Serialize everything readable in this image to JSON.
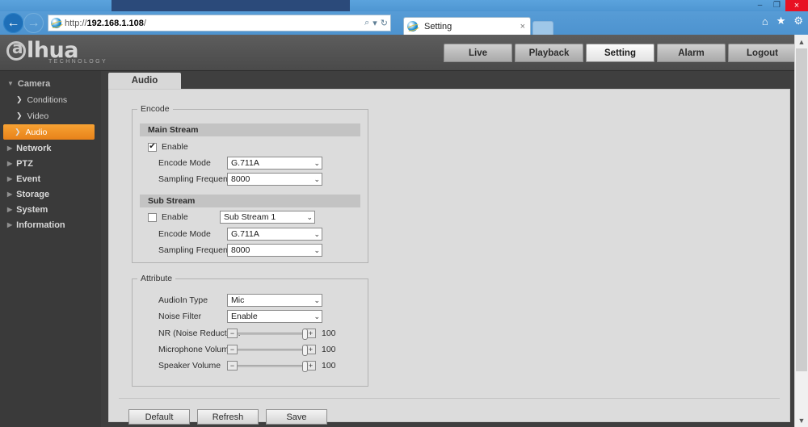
{
  "browser": {
    "url": "http://192.168.1.108/",
    "url_protocol": "http://",
    "url_host": "192.168.1.108",
    "url_path": "/",
    "tab_title": "Setting",
    "tab_close_label": "×",
    "back_icon": "back-arrow-icon",
    "forward_icon": "forward-arrow-icon",
    "search_icon": "⌕",
    "dropdown_icon": "▾",
    "refresh_icon": "↻",
    "home_icon": "⌂",
    "favorites_icon": "★",
    "tools_icon": "⚙",
    "window_minimize": "–",
    "window_maximize": "❐",
    "window_close": "×"
  },
  "header": {
    "logo_text": "lhua",
    "logo_sub": "TECHNOLOGY",
    "nav": [
      {
        "label": "Live",
        "active": false
      },
      {
        "label": "Playback",
        "active": false
      },
      {
        "label": "Setting",
        "active": true
      },
      {
        "label": "Alarm",
        "active": false
      },
      {
        "label": "Logout",
        "active": false
      }
    ]
  },
  "sidebar": {
    "groups": [
      {
        "label": "Camera",
        "caret": "▼",
        "children": [
          {
            "label": "Conditions",
            "chev": "❯",
            "active": false
          },
          {
            "label": "Video",
            "chev": "❯",
            "active": false
          },
          {
            "label": "Audio",
            "chev": "❯",
            "active": true
          }
        ]
      }
    ],
    "items": [
      {
        "label": "Network",
        "caret": "▶"
      },
      {
        "label": "PTZ",
        "caret": "▶"
      },
      {
        "label": "Event",
        "caret": "▶"
      },
      {
        "label": "Storage",
        "caret": "▶"
      },
      {
        "label": "System",
        "caret": "▶"
      },
      {
        "label": "Information",
        "caret": "▶"
      }
    ]
  },
  "content": {
    "tab_label": "Audio",
    "encode": {
      "legend": "Encode",
      "main_stream": {
        "heading": "Main Stream",
        "enable_label": "Enable",
        "enable_checked": true,
        "check_glyph": "✔",
        "encode_mode_label": "Encode Mode",
        "encode_mode_value": "G.711A",
        "sampling_label": "Sampling Frequency",
        "sampling_value": "8000"
      },
      "sub_stream": {
        "heading": "Sub Stream",
        "enable_label": "Enable",
        "enable_checked": false,
        "stream_select_value": "Sub Stream 1",
        "encode_mode_label": "Encode Mode",
        "encode_mode_value": "G.711A",
        "sampling_label": "Sampling Frequency",
        "sampling_value": "8000"
      }
    },
    "attribute": {
      "legend": "Attribute",
      "audioin_type_label": "AudioIn Type",
      "audioin_type_value": "Mic",
      "noise_filter_label": "Noise Filter",
      "noise_filter_value": "Enable",
      "sliders": [
        {
          "label": "NR (Noise Reductio...",
          "value": "100",
          "percent": 100
        },
        {
          "label": "Microphone Volume",
          "value": "100",
          "percent": 100
        },
        {
          "label": "Speaker Volume",
          "value": "100",
          "percent": 100
        }
      ],
      "minus_glyph": "−",
      "plus_glyph": "+"
    },
    "buttons": [
      {
        "label": "Default"
      },
      {
        "label": "Refresh"
      },
      {
        "label": "Save"
      }
    ],
    "chevron_glyph": "⌄"
  },
  "colors": {
    "accent_orange": "#e8821a",
    "panel_gray": "#dcdcdc",
    "sidebar_dark": "#3a3a3a",
    "browser_blue": "#5b9bd5",
    "close_red": "#e81123"
  }
}
